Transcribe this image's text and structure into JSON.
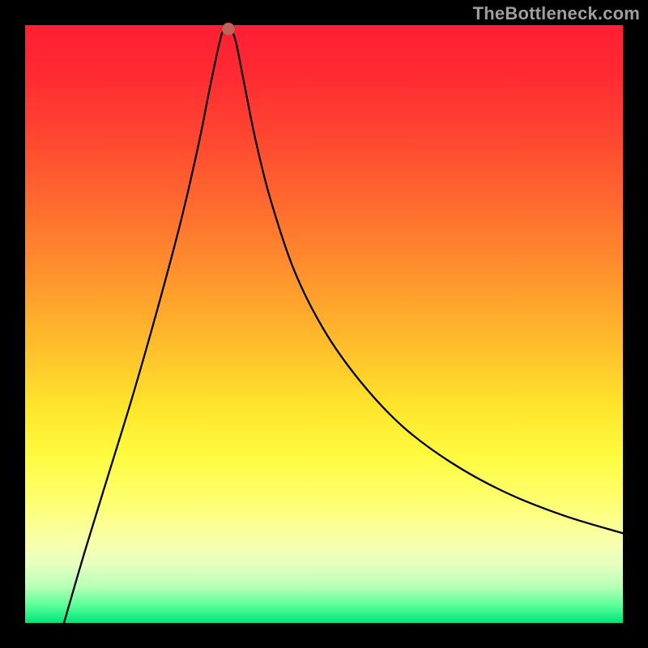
{
  "watermark": "TheBottleneck.com",
  "marker": {
    "x_pct": 34.0,
    "y_pct": 99.3
  },
  "chart_data": {
    "type": "line",
    "title": "",
    "xlabel": "",
    "ylabel": "",
    "xlim_pct": [
      0,
      100
    ],
    "ylim_pct": [
      0,
      100
    ],
    "background": "rainbow-vertical-gradient",
    "curve_points_pct": [
      [
        6.5,
        0.0
      ],
      [
        10.0,
        12.0
      ],
      [
        14.0,
        25.0
      ],
      [
        18.0,
        38.0
      ],
      [
        22.0,
        52.0
      ],
      [
        26.0,
        67.0
      ],
      [
        29.0,
        80.0
      ],
      [
        31.0,
        90.0
      ],
      [
        32.5,
        97.0
      ],
      [
        33.2,
        99.0
      ],
      [
        34.5,
        99.0
      ],
      [
        35.3,
        97.0
      ],
      [
        36.5,
        91.0
      ],
      [
        38.5,
        81.0
      ],
      [
        41.0,
        71.0
      ],
      [
        45.0,
        59.0
      ],
      [
        50.0,
        49.0
      ],
      [
        56.0,
        40.5
      ],
      [
        63.0,
        33.0
      ],
      [
        71.0,
        27.0
      ],
      [
        80.0,
        22.0
      ],
      [
        90.0,
        18.0
      ],
      [
        100.0,
        15.0
      ]
    ],
    "marker": {
      "x_pct": 34.0,
      "y_pct": 99.3,
      "color": "#c0615c"
    }
  }
}
